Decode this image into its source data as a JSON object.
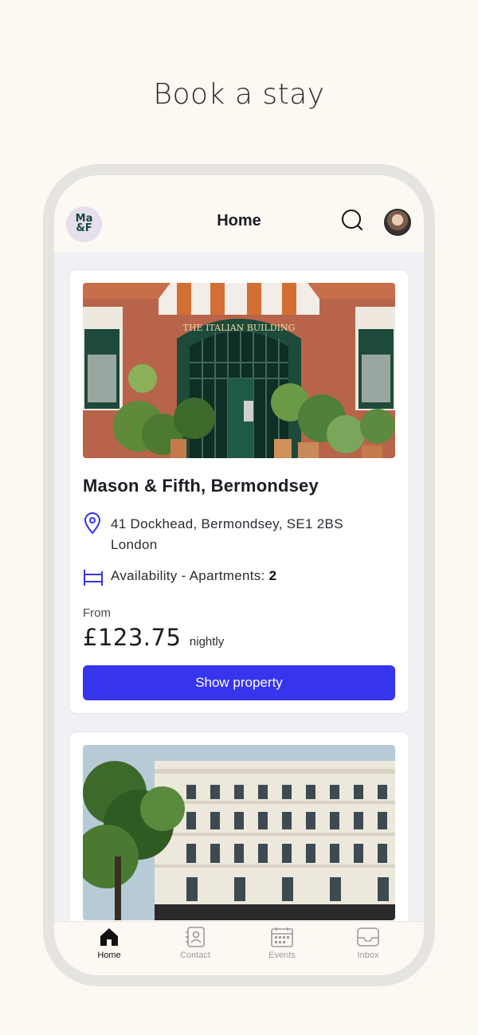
{
  "page": {
    "headline": "Book a stay"
  },
  "app": {
    "logo_text_line1": "Ma",
    "logo_text_line2": "&F",
    "title": "Home",
    "search_icon": "search-icon",
    "avatar": "user-avatar"
  },
  "listings": [
    {
      "name": "Mason & Fifth, Bermondsey",
      "photo_label": "THE ITALIAN BUILDING",
      "address_line1": "41 Dockhead, Bermondsey, SE1 2BS",
      "address_line2": "London",
      "availability_label": "Availability - Apartments:",
      "availability_count": "2",
      "from_label": "From",
      "price": "£123.75",
      "price_unit": "nightly",
      "button_label": "Show property"
    }
  ],
  "tabs": [
    {
      "label": "Home",
      "icon": "home-icon",
      "active": true
    },
    {
      "label": "Contact",
      "icon": "contact-icon",
      "active": false
    },
    {
      "label": "Events",
      "icon": "calendar-icon",
      "active": false
    },
    {
      "label": "Inbox",
      "icon": "inbox-icon",
      "active": false
    }
  ],
  "colors": {
    "accent": "#3634ec",
    "background": "#fcf9f2",
    "logo_bg": "#e5e0ec"
  }
}
